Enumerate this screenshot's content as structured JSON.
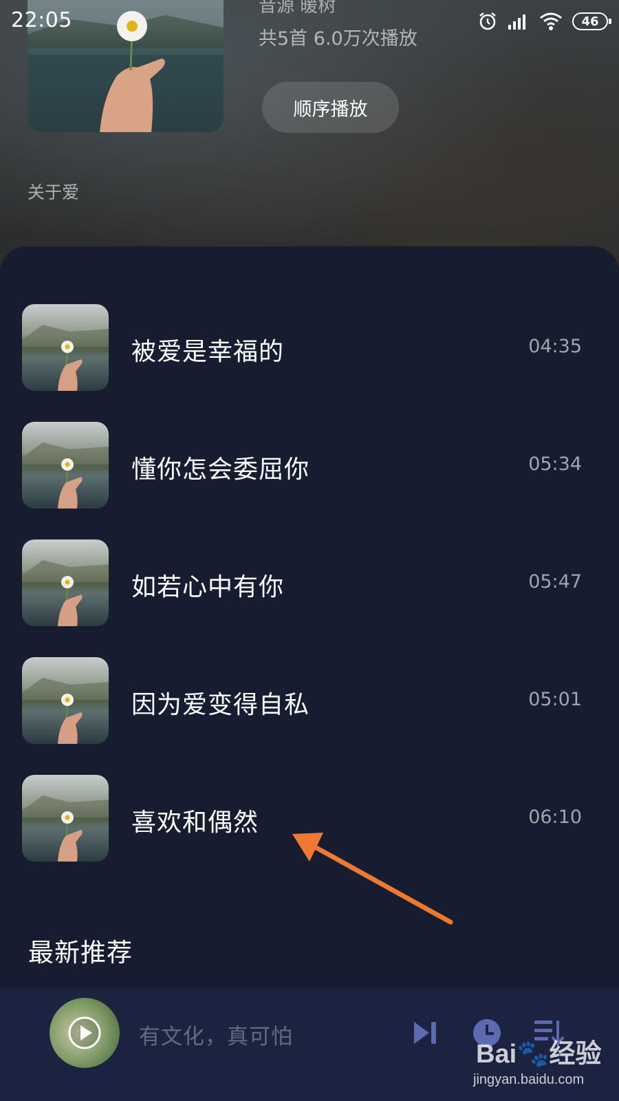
{
  "status_bar": {
    "time": "22:05",
    "battery": "46",
    "icons": [
      "alarm-icon",
      "signal-icon",
      "wifi-icon",
      "battery-icon"
    ]
  },
  "playlist": {
    "source": "音源  暖树",
    "stats": "共5首   6.0万次播放",
    "play_order_label": "顺序播放",
    "description": "关于爱"
  },
  "songs": [
    {
      "title": "被爱是幸福的",
      "duration": "04:35"
    },
    {
      "title": "懂你怎会委屈你",
      "duration": "05:34"
    },
    {
      "title": "如若心中有你",
      "duration": "05:47"
    },
    {
      "title": "因为爱变得自私",
      "duration": "05:01"
    },
    {
      "title": "喜欢和偶然",
      "duration": "06:10"
    }
  ],
  "section": {
    "title": "最新推荐"
  },
  "mini_player": {
    "title": "有文化，真可怕",
    "icons": [
      "play-icon",
      "next-icon",
      "timer-icon",
      "playlist-icon"
    ]
  },
  "watermark": {
    "logo": "Bai🐾经验",
    "url": "jingyan.baidu.com"
  },
  "colors": {
    "panel": "#171d31",
    "mini_player": "#1c2340",
    "accent_icon": "#5d6ab0",
    "annotation_arrow": "#f07832"
  }
}
